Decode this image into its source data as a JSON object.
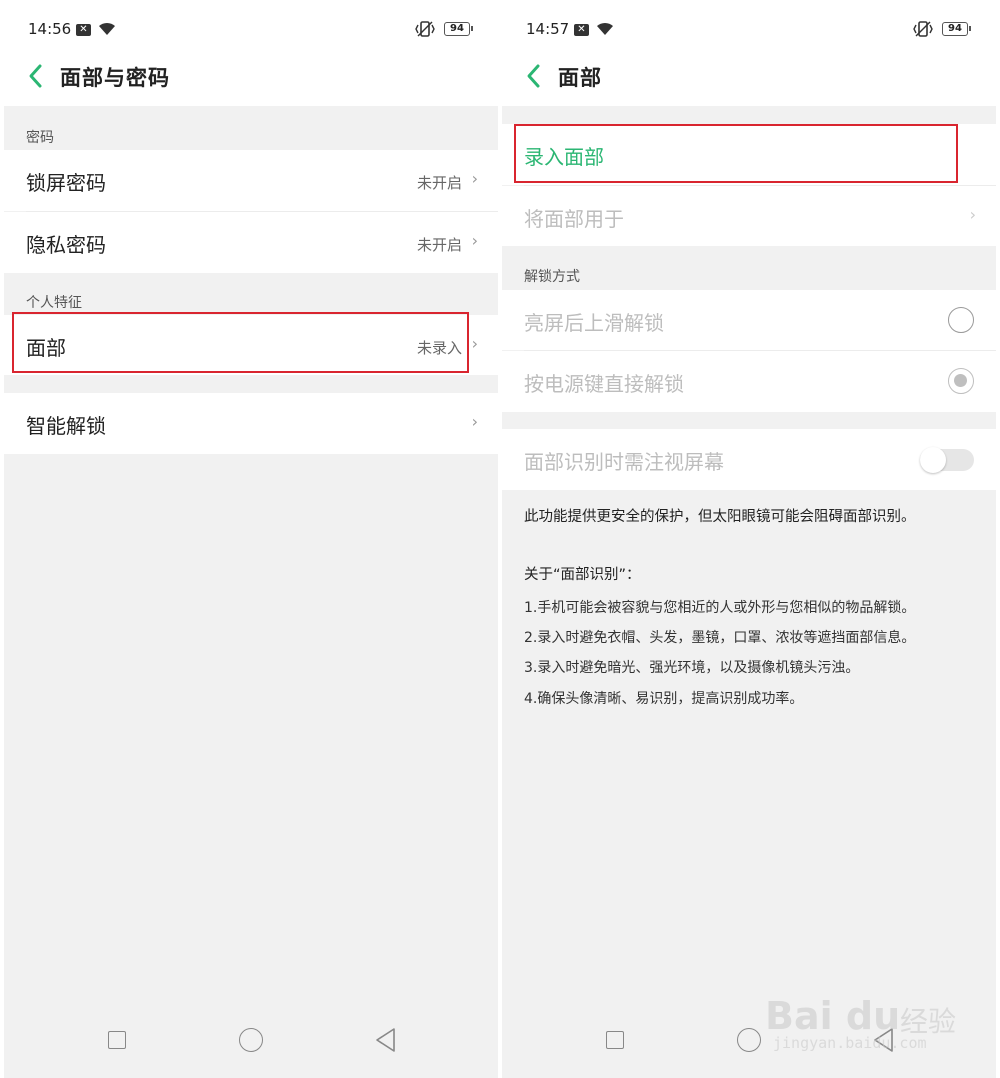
{
  "left": {
    "status": {
      "time": "14:56",
      "battery": "94"
    },
    "header": {
      "title": "面部与密码"
    },
    "section_password": "密码",
    "rows_password": [
      {
        "label": "锁屏密码",
        "value": "未开启"
      },
      {
        "label": "隐私密码",
        "value": "未开启"
      }
    ],
    "section_personal": "个人特征",
    "face_row": {
      "label": "面部",
      "value": "未录入"
    },
    "smart_unlock": {
      "label": "智能解锁"
    }
  },
  "right": {
    "status": {
      "time": "14:57",
      "battery": "94"
    },
    "header": {
      "title": "面部"
    },
    "enroll_face": "录入面部",
    "use_face_for": "将面部用于",
    "section_unlock": "解锁方式",
    "unlock_options": [
      {
        "label": "亮屏后上滑解锁",
        "checked": false
      },
      {
        "label": "按电源键直接解锁",
        "checked": true
      }
    ],
    "attention": {
      "label": "面部识别时需注视屏幕",
      "enabled": false
    },
    "attention_desc": "此功能提供更安全的保护，但太阳眼镜可能会阻碍面部识别。",
    "about_title": "关于“面部识别”：",
    "about_items": [
      "1.手机可能会被容貌与您相近的人或外形与您相似的物品解锁。",
      "2.录入时避免衣帽、头发，墨镜，口罩、浓妆等遮挡面部信息。",
      "3.录入时避免暗光、强光环境，以及摄像机镜头污浊。",
      "4.确保头像清晰、易识别，提高识别成功率。"
    ]
  },
  "chevron": "›",
  "watermark": {
    "logo": "Bai du",
    "brand": "经验",
    "url": "jingyan.baidu.com"
  },
  "colors": {
    "accent": "#2bb673",
    "highlight": "#d9252f",
    "background": "#f1f1f1"
  }
}
